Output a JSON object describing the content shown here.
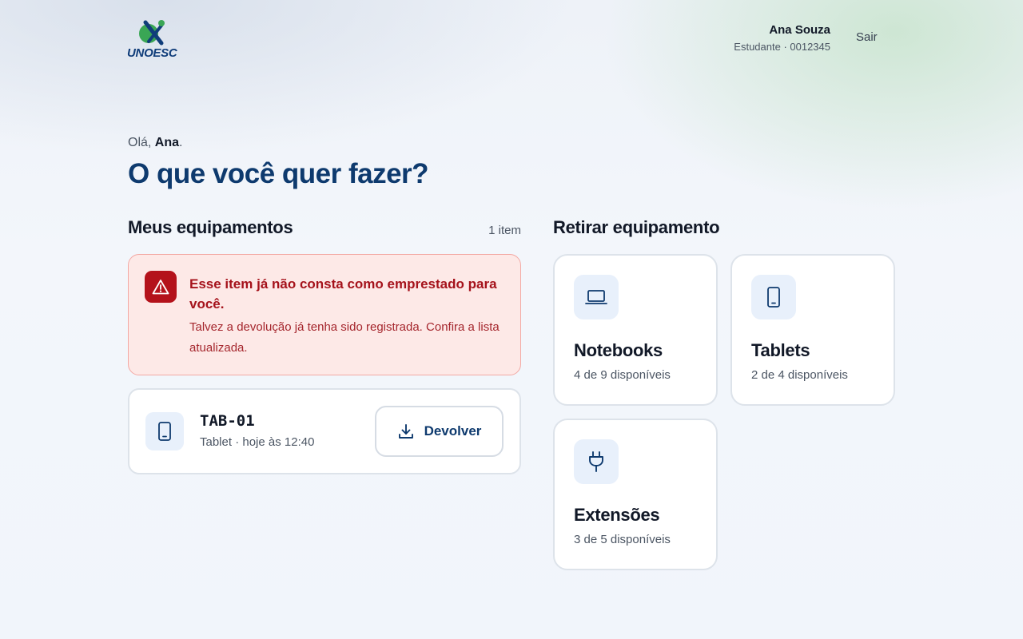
{
  "header": {
    "logo_text": "UNOESC",
    "user_name": "Ana Souza",
    "user_sub": "Estudante · 0012345",
    "logout_label": "Sair"
  },
  "greeting": {
    "prefix": "Olá, ",
    "name": "Ana",
    "suffix": "."
  },
  "page_title": "O que você quer fazer?",
  "my_equipment": {
    "title": "Meus equipamentos",
    "count": "1 item",
    "alert": {
      "icon": "warning-triangle-icon",
      "title": "Esse item já não consta como emprestado para você.",
      "message": "Talvez a devolução já tenha sido registrada. Confira a lista atualizada."
    },
    "items": [
      {
        "icon": "tablet-icon",
        "code": "TAB-01",
        "subtitle": "Tablet · hoje às 12:40",
        "action_label": "Devolver",
        "action_icon": "download-icon"
      }
    ]
  },
  "checkout": {
    "title": "Retirar equipamento",
    "categories": [
      {
        "name": "Notebooks",
        "availability": "4 de 9 disponíveis",
        "icon": "laptop-icon"
      },
      {
        "name": "Tablets",
        "availability": "2 de 4 disponíveis",
        "icon": "tablet-icon"
      },
      {
        "name": "Extensões",
        "availability": "3 de 5 disponíveis",
        "icon": "plug-icon"
      }
    ]
  },
  "colors": {
    "primary": "#0e3a6e",
    "danger": "#b4121b",
    "danger_bg": "#fde9e7",
    "icon_bg": "#e8f0fb",
    "logo_green": "#3aa655"
  }
}
